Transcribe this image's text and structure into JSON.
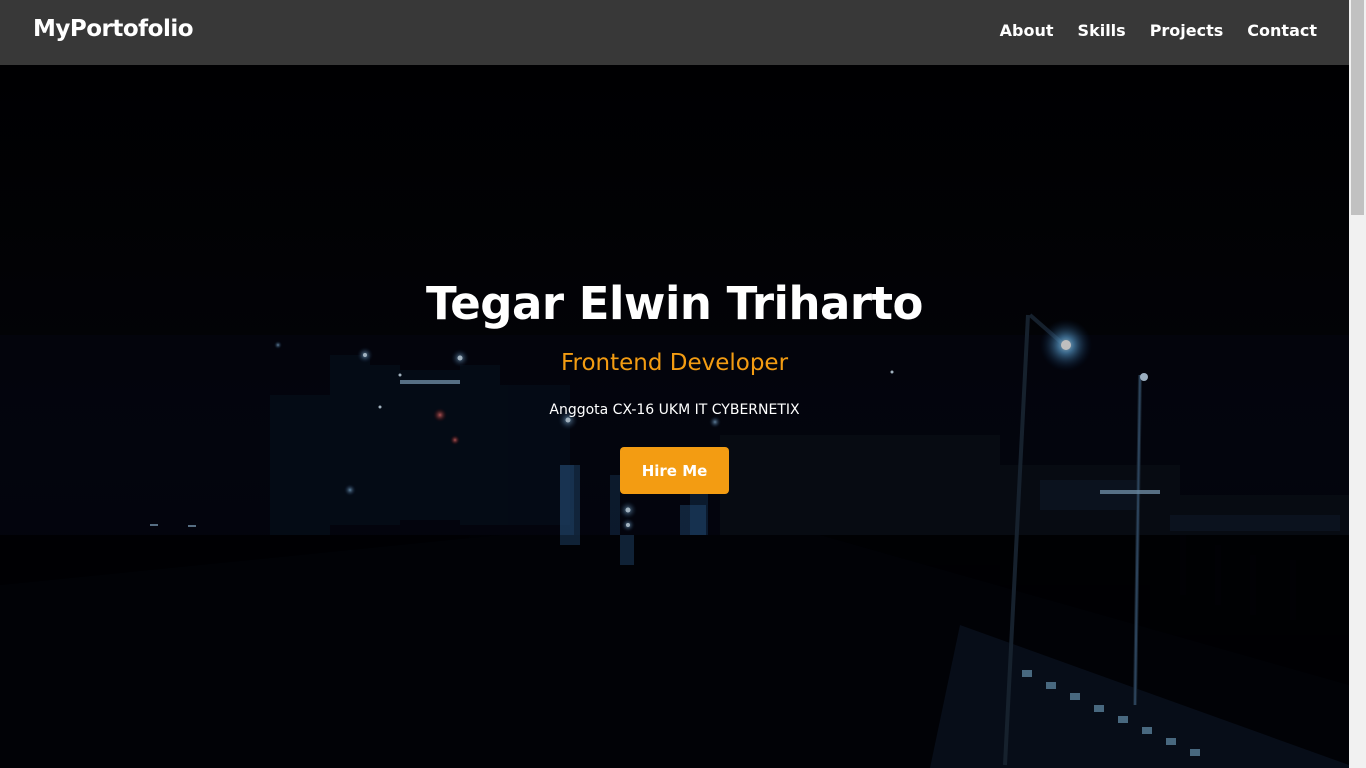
{
  "navbar": {
    "brand": "MyPortofolio",
    "links": [
      {
        "label": "About"
      },
      {
        "label": "Skills"
      },
      {
        "label": "Projects"
      },
      {
        "label": "Contact"
      }
    ]
  },
  "hero": {
    "name": "Tegar Elwin Triharto",
    "role": "Frontend Developer",
    "description": "Anggota CX-16 UKM IT CYBERNETIX",
    "cta_label": "Hire Me",
    "background": "night-city-street-photo"
  },
  "colors": {
    "navbar_bg": "#383838",
    "accent": "#f39c12",
    "text": "#ffffff",
    "hero_bg": "#020205"
  }
}
